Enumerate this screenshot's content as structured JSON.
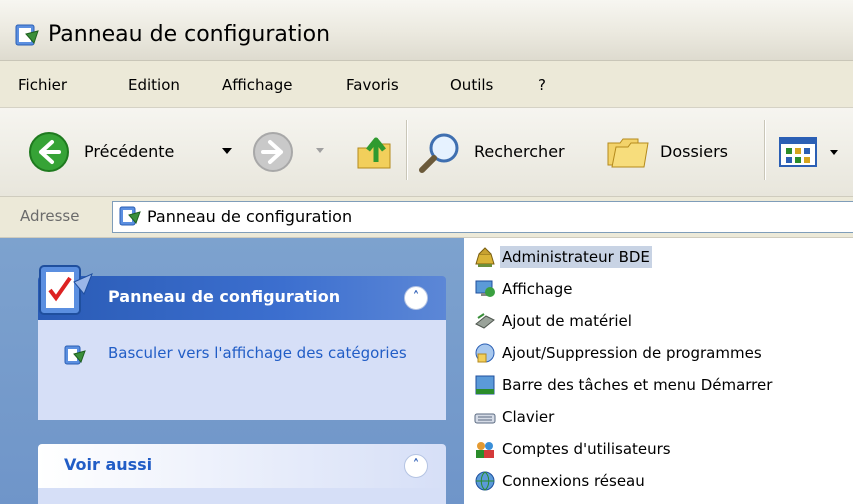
{
  "window": {
    "title": "Panneau de configuration"
  },
  "menu": [
    "Fichier",
    "Edition",
    "Affichage",
    "Favoris",
    "Outils",
    "?"
  ],
  "toolbar": {
    "back_label": "Précédente",
    "search_label": "Rechercher",
    "folders_label": "Dossiers"
  },
  "address": {
    "label": "Adresse",
    "value": "Panneau de configuration"
  },
  "task_pane": {
    "panel1_title": "Panneau de configuration",
    "switch_view_label": "Basculer vers l'affichage des catégories",
    "panel2_title": "Voir aussi"
  },
  "items": [
    {
      "label": "Administrateur BDE",
      "icon": "bde-admin-icon",
      "selected": true
    },
    {
      "label": "Affichage",
      "icon": "display-icon"
    },
    {
      "label": "Ajout de matériel",
      "icon": "add-hardware-icon"
    },
    {
      "label": "Ajout/Suppression de programmes",
      "icon": "add-remove-programs-icon"
    },
    {
      "label": "Barre des tâches et menu Démarrer",
      "icon": "taskbar-icon"
    },
    {
      "label": "Clavier",
      "icon": "keyboard-icon"
    },
    {
      "label": "Comptes d'utilisateurs",
      "icon": "user-accounts-icon"
    },
    {
      "label": "Connexions réseau",
      "icon": "network-icon"
    }
  ],
  "colors": {
    "task_header": "#2a5bb5",
    "task_link": "#215dc6",
    "pane_background": "#7da2ce",
    "selection": "#c8d3e4"
  }
}
